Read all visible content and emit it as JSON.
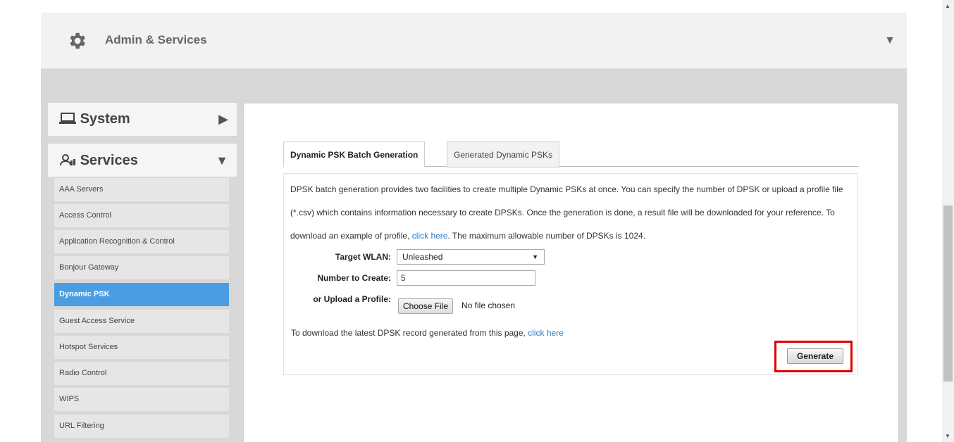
{
  "header": {
    "title": "Admin & Services",
    "gear_icon": "gear-icon",
    "collapse_icon": "triangle-down-icon"
  },
  "sidebar": {
    "system": {
      "label": "System",
      "icon": "laptop-icon",
      "arrow": "▶"
    },
    "services": {
      "label": "Services",
      "icon": "users-icon",
      "arrow": "▼"
    },
    "items": [
      {
        "label": "AAA Servers"
      },
      {
        "label": "Access Control"
      },
      {
        "label": "Application Recognition & Control"
      },
      {
        "label": "Bonjour Gateway"
      },
      {
        "label": "Dynamic PSK"
      },
      {
        "label": "Guest Access Service"
      },
      {
        "label": "Hotspot Services"
      },
      {
        "label": "Radio Control"
      },
      {
        "label": "WIPS"
      },
      {
        "label": "URL Filtering"
      }
    ],
    "active_item": "Dynamic PSK"
  },
  "tabs": [
    {
      "label": "Dynamic PSK Batch Generation"
    },
    {
      "label": "Generated Dynamic PSKs"
    }
  ],
  "description": {
    "text1": "DPSK batch generation provides two facilities to create multiple Dynamic PSKs at once. You can specify the number of DPSK or upload a profile file (*.csv) which contains information necessary to create DPSKs. Once the generation is done, a result file will be downloaded for your reference. To download an example of profile, ",
    "link": "click here",
    "text2": ". The maximum allowable number of DPSKs is 1024."
  },
  "form": {
    "target_wlan_label": "Target WLAN:",
    "target_wlan_value": "Unleashed",
    "number_label": "Number to Create:",
    "number_value": "5",
    "upload_label": "or Upload a Profile:",
    "choose_file": "Choose File",
    "file_status": "No file chosen"
  },
  "download": {
    "text": "To download the latest DPSK record generated from this page, ",
    "link": "click here"
  },
  "generate_label": "Generate",
  "colors": {
    "active_item": "#4a9de0",
    "link": "#2a7bc3",
    "highlight": "#e00000"
  }
}
